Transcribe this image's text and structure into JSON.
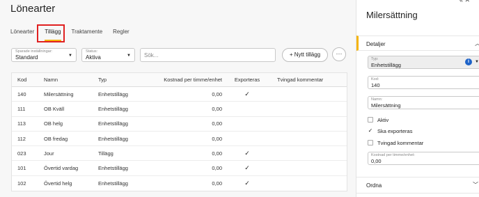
{
  "page": {
    "title": "Lönearter"
  },
  "tabs": [
    {
      "label": "Lönearter",
      "active": false
    },
    {
      "label": "Tillägg",
      "active": true
    },
    {
      "label": "Traktamente",
      "active": false
    },
    {
      "label": "Regler",
      "active": false
    }
  ],
  "filters": {
    "saved_settings": {
      "label": "Sparade inställningar:",
      "value": "Standard"
    },
    "status": {
      "label": "Status:",
      "value": "Aktiva"
    },
    "search_placeholder": "Sök...",
    "new_button": "+ Nytt tillägg",
    "more_button": "···"
  },
  "table": {
    "headers": {
      "kod": "Kod",
      "namn": "Namn",
      "typ": "Typ",
      "kostnad": "Kostnad per timme/enhet",
      "exporteras": "Exporteras",
      "tvingad": "Tvingad kommentar"
    },
    "rows": [
      {
        "kod": "140",
        "namn": "Milersättning",
        "typ": "Enhetstillägg",
        "kostnad": "0,00",
        "exporteras": "✓",
        "tvingad": ""
      },
      {
        "kod": "111",
        "namn": "OB Kväll",
        "typ": "Enhetstillägg",
        "kostnad": "0,00",
        "exporteras": "",
        "tvingad": ""
      },
      {
        "kod": "113",
        "namn": "OB helg",
        "typ": "Enhetstillägg",
        "kostnad": "0,00",
        "exporteras": "",
        "tvingad": ""
      },
      {
        "kod": "112",
        "namn": "OB fredag",
        "typ": "Enhetstillägg",
        "kostnad": "0,00",
        "exporteras": "",
        "tvingad": ""
      },
      {
        "kod": "023",
        "namn": "Jour",
        "typ": "Tillägg",
        "kostnad": "0,00",
        "exporteras": "✓",
        "tvingad": ""
      },
      {
        "kod": "101",
        "namn": "Övertid vardag",
        "typ": "Enhetstillägg",
        "kostnad": "0,00",
        "exporteras": "✓",
        "tvingad": ""
      },
      {
        "kod": "102",
        "namn": "Övertid helg",
        "typ": "Enhetstillägg",
        "kostnad": "0,00",
        "exporteras": "✓",
        "tvingad": ""
      }
    ]
  },
  "panel": {
    "title": "Milersättning",
    "collapse_icons": "«  ✕",
    "details_section": "Detaljer",
    "typ": {
      "label": "Typ:",
      "value": "Enhetstillägg"
    },
    "kod": {
      "label": "Kod:",
      "value": "140"
    },
    "namn": {
      "label": "Namn:",
      "value": "Milersättning"
    },
    "checkboxes": [
      {
        "label": "Aktiv",
        "checked": false
      },
      {
        "label": "Ska exporteras",
        "checked": true
      },
      {
        "label": "Tvingad kommentar",
        "checked": false
      }
    ],
    "kostnad": {
      "label": "Kostnad per timme/enhet:",
      "value": "0,00"
    },
    "ordna_section": "Ordna"
  },
  "colors": {
    "accent": "#f5b40a",
    "highlight": "#e02020",
    "info": "#1e63c8"
  },
  "icons": [
    "chevron-down-icon",
    "check-icon",
    "info-icon",
    "chevron-up-icon",
    "close-icon",
    "collapse-icon",
    "more-icon"
  ]
}
